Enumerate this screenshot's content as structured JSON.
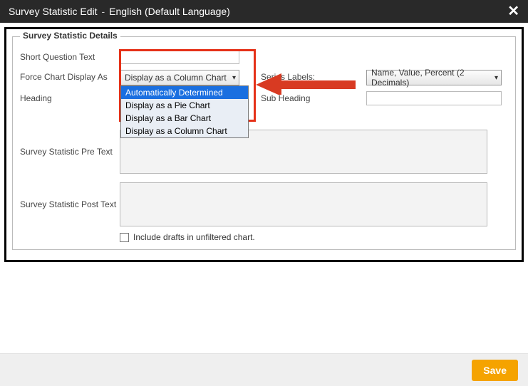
{
  "header": {
    "title": "Survey Statistic Edit",
    "sep": "-",
    "lang": "English (Default Language)"
  },
  "fieldset_legend": "Survey Statistic Details",
  "labels": {
    "short_question_text": "Short Question Text",
    "force_chart_display_as": "Force Chart Display As",
    "heading": "Heading",
    "series_labels": "Series Labels:",
    "sub_heading": "Sub Heading",
    "pre_text": "Survey Statistic Pre Text",
    "post_text": "Survey Statistic Post Text",
    "include_drafts": "Include drafts in unfiltered chart."
  },
  "force_chart_select": {
    "selected": "Display as a Column Chart",
    "options": [
      "Automatically Determined",
      "Display as a Pie Chart",
      "Display as a Bar Chart",
      "Display as a Column Chart"
    ]
  },
  "series_labels_select": {
    "selected": "Name, Value, Percent (2 Decimals)"
  },
  "footer": {
    "save": "Save"
  }
}
